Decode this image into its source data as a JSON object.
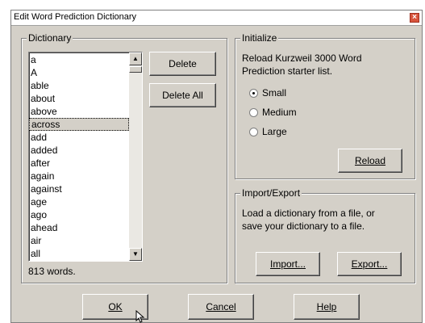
{
  "window": {
    "title": "Edit Word Prediction Dictionary",
    "close_glyph": "×"
  },
  "dictionary": {
    "group_title": "Dictionary",
    "words": [
      "a",
      "A",
      "able",
      "about",
      "above",
      "across",
      "add",
      "added",
      "after",
      "again",
      "against",
      "age",
      "ago",
      "ahead",
      "air",
      "all"
    ],
    "selected_index": 5,
    "count_text": "813 words.",
    "delete_label": "Delete",
    "delete_all_label": "Delete All"
  },
  "initialize": {
    "group_title": "Initialize",
    "description": [
      "Reload Kurzweil 3000 Word",
      "Prediction starter list."
    ],
    "options": [
      {
        "label": "Small",
        "selected": true
      },
      {
        "label": "Medium",
        "selected": false
      },
      {
        "label": "Large",
        "selected": false
      }
    ],
    "reload_label": "Reload"
  },
  "import_export": {
    "group_title": "Import/Export",
    "description": [
      "Load a dictionary from a file, or",
      "save your dictionary to a file."
    ],
    "import_label": "Import...",
    "export_label": "Export..."
  },
  "footer": {
    "ok_label": "OK",
    "cancel_label": "Cancel",
    "help_label": "Help"
  }
}
